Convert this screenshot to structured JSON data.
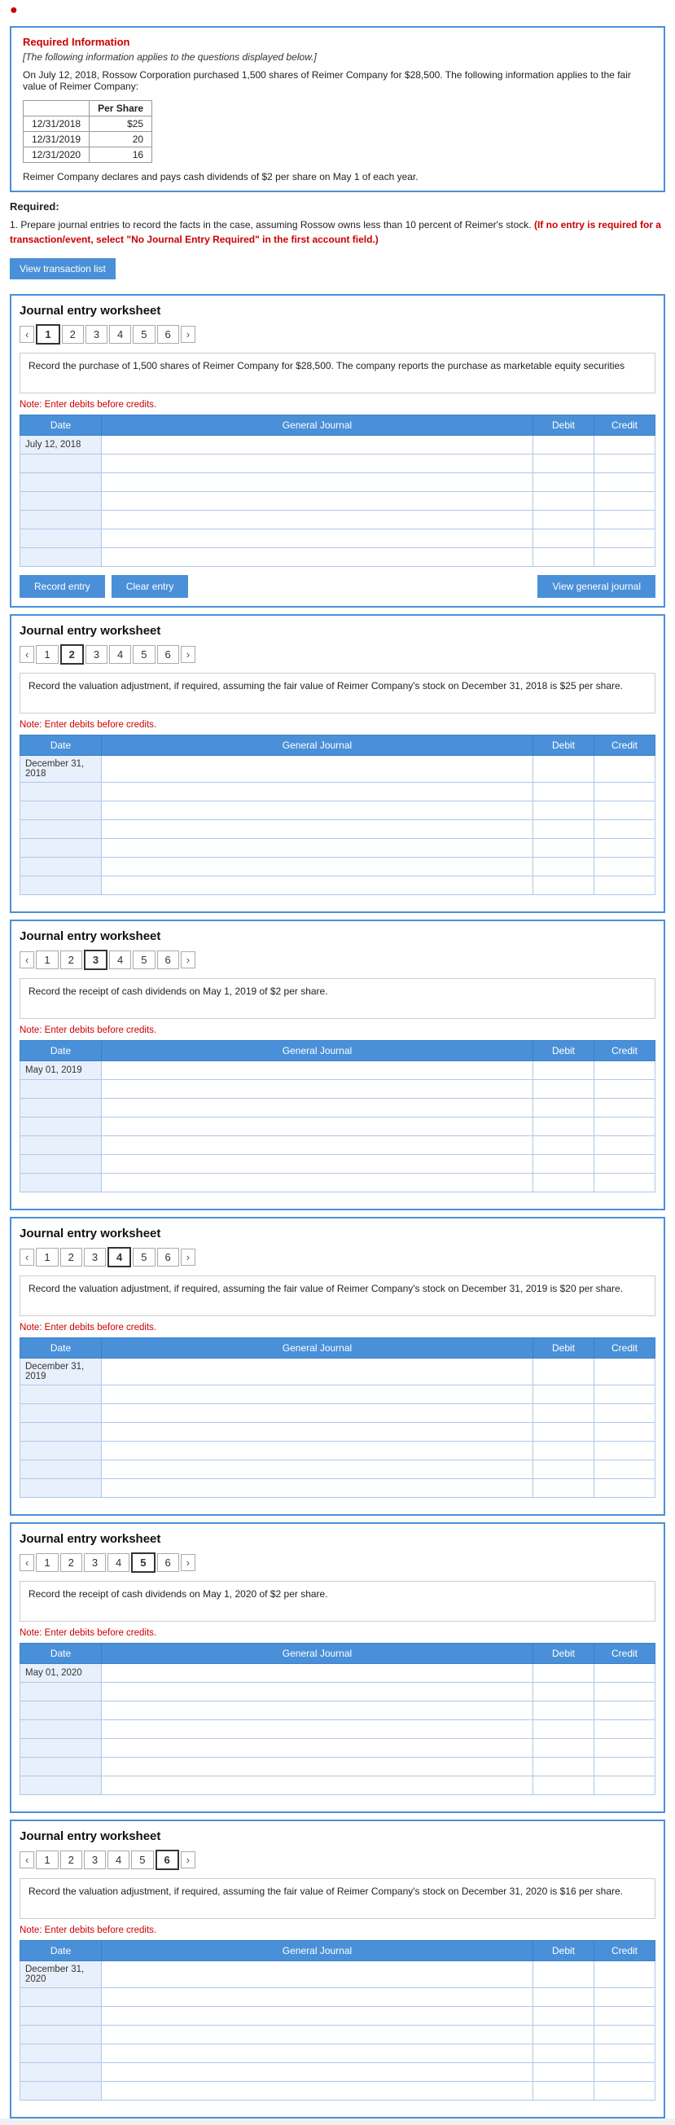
{
  "alert_icon": "!",
  "required_info": {
    "title": "Required Information",
    "subtitle": "[The following information applies to the questions displayed below.]",
    "paragraph": "On July 12, 2018, Rossow Corporation purchased 1,500 shares of Reimer Company for $28,500. The following information applies to the fair value of Reimer Company:",
    "table": {
      "header": [
        "",
        "Per Share"
      ],
      "rows": [
        [
          "12/31/2018",
          "$25"
        ],
        [
          "12/31/2019",
          "20"
        ],
        [
          "12/31/2020",
          "16"
        ]
      ]
    },
    "dividends": "Reimer Company declares and pays cash dividends of $2 per share on May 1 of each year."
  },
  "required_label": "Required:",
  "instruction": "1. Prepare journal entries to record the facts in the case, assuming Rossow owns less than 10 percent of Reimer's stock.",
  "instruction_red": "(If no entry is required for a transaction/event, select \"No Journal Entry Required\" in the first account field.)",
  "view_transaction_btn": "View transaction list",
  "worksheets": [
    {
      "title": "Journal entry worksheet",
      "tabs": [
        1,
        2,
        3,
        4,
        5,
        6
      ],
      "active_tab": 1,
      "instruction": "Record the purchase of 1,500 shares of Reimer Company for $28,500. The company reports the purchase as marketable equity securities",
      "note": "Note: Enter debits before credits.",
      "columns": [
        "Date",
        "General Journal",
        "Debit",
        "Credit"
      ],
      "rows": [
        {
          "date": "July 12, 2018",
          "journal": "",
          "debit": "",
          "credit": ""
        },
        {
          "date": "",
          "journal": "",
          "debit": "",
          "credit": ""
        },
        {
          "date": "",
          "journal": "",
          "debit": "",
          "credit": ""
        },
        {
          "date": "",
          "journal": "",
          "debit": "",
          "credit": ""
        },
        {
          "date": "",
          "journal": "",
          "debit": "",
          "credit": ""
        },
        {
          "date": "",
          "journal": "",
          "debit": "",
          "credit": ""
        },
        {
          "date": "",
          "journal": "",
          "debit": "",
          "credit": ""
        }
      ],
      "buttons": {
        "record": "Record entry",
        "clear": "Clear entry",
        "view": "View general journal"
      }
    },
    {
      "title": "Journal entry worksheet",
      "tabs": [
        1,
        2,
        3,
        4,
        5,
        6
      ],
      "active_tab": 2,
      "instruction": "Record the valuation adjustment, if required, assuming the fair value of Reimer Company's stock on December 31, 2018 is $25 per share.",
      "note": "Note: Enter debits before credits.",
      "columns": [
        "Date",
        "General Journal",
        "Debit",
        "Credit"
      ],
      "rows": [
        {
          "date": "December 31, 2018",
          "journal": "",
          "debit": "",
          "credit": ""
        },
        {
          "date": "",
          "journal": "",
          "debit": "",
          "credit": ""
        },
        {
          "date": "",
          "journal": "",
          "debit": "",
          "credit": ""
        },
        {
          "date": "",
          "journal": "",
          "debit": "",
          "credit": ""
        },
        {
          "date": "",
          "journal": "",
          "debit": "",
          "credit": ""
        },
        {
          "date": "",
          "journal": "",
          "debit": "",
          "credit": ""
        },
        {
          "date": "",
          "journal": "",
          "debit": "",
          "credit": ""
        }
      ],
      "buttons": {
        "record": "Record entry",
        "clear": "Clear entry",
        "view": "View general journal"
      }
    },
    {
      "title": "Journal entry worksheet",
      "tabs": [
        1,
        2,
        3,
        4,
        5,
        6
      ],
      "active_tab": 3,
      "instruction": "Record the receipt of cash dividends on May 1, 2019 of $2 per share.",
      "note": "Note: Enter debits before credits.",
      "columns": [
        "Date",
        "General Journal",
        "Debit",
        "Credit"
      ],
      "rows": [
        {
          "date": "May 01, 2019",
          "journal": "",
          "debit": "",
          "credit": ""
        },
        {
          "date": "",
          "journal": "",
          "debit": "",
          "credit": ""
        },
        {
          "date": "",
          "journal": "",
          "debit": "",
          "credit": ""
        },
        {
          "date": "",
          "journal": "",
          "debit": "",
          "credit": ""
        },
        {
          "date": "",
          "journal": "",
          "debit": "",
          "credit": ""
        },
        {
          "date": "",
          "journal": "",
          "debit": "",
          "credit": ""
        },
        {
          "date": "",
          "journal": "",
          "debit": "",
          "credit": ""
        }
      ],
      "buttons": {
        "record": "Record entry",
        "clear": "Clear entry",
        "view": "View general journal"
      }
    },
    {
      "title": "Journal entry worksheet",
      "tabs": [
        1,
        2,
        3,
        4,
        5,
        6
      ],
      "active_tab": 4,
      "instruction": "Record the valuation adjustment, if required, assuming the fair value of Reimer Company's stock on December 31, 2019 is $20 per share.",
      "note": "Note: Enter debits before credits.",
      "columns": [
        "Date",
        "General Journal",
        "Debit",
        "Credit"
      ],
      "rows": [
        {
          "date": "December 31, 2019",
          "journal": "",
          "debit": "",
          "credit": ""
        },
        {
          "date": "",
          "journal": "",
          "debit": "",
          "credit": ""
        },
        {
          "date": "",
          "journal": "",
          "debit": "",
          "credit": ""
        },
        {
          "date": "",
          "journal": "",
          "debit": "",
          "credit": ""
        },
        {
          "date": "",
          "journal": "",
          "debit": "",
          "credit": ""
        },
        {
          "date": "",
          "journal": "",
          "debit": "",
          "credit": ""
        },
        {
          "date": "",
          "journal": "",
          "debit": "",
          "credit": ""
        }
      ],
      "buttons": {
        "record": "Record entry",
        "clear": "Clear entry",
        "view": "View general journal"
      }
    },
    {
      "title": "Journal entry worksheet",
      "tabs": [
        1,
        2,
        3,
        4,
        5,
        6
      ],
      "active_tab": 5,
      "instruction": "Record the receipt of cash dividends on May 1, 2020 of $2 per share.",
      "note": "Note: Enter debits before credits.",
      "columns": [
        "Date",
        "General Journal",
        "Debit",
        "Credit"
      ],
      "rows": [
        {
          "date": "May 01, 2020",
          "journal": "",
          "debit": "",
          "credit": ""
        },
        {
          "date": "",
          "journal": "",
          "debit": "",
          "credit": ""
        },
        {
          "date": "",
          "journal": "",
          "debit": "",
          "credit": ""
        },
        {
          "date": "",
          "journal": "",
          "debit": "",
          "credit": ""
        },
        {
          "date": "",
          "journal": "",
          "debit": "",
          "credit": ""
        },
        {
          "date": "",
          "journal": "",
          "debit": "",
          "credit": ""
        },
        {
          "date": "",
          "journal": "",
          "debit": "",
          "credit": ""
        }
      ],
      "buttons": {
        "record": "Record entry",
        "clear": "Clear entry",
        "view": "View general journal"
      }
    },
    {
      "title": "Journal entry worksheet",
      "tabs": [
        1,
        2,
        3,
        4,
        5,
        6
      ],
      "active_tab": 6,
      "instruction": "Record the valuation adjustment, if required, assuming the fair value of Reimer Company's stock on December 31, 2020 is $16 per share.",
      "note": "Note: Enter debits before credits.",
      "columns": [
        "Date",
        "General Journal",
        "Debit",
        "Credit"
      ],
      "rows": [
        {
          "date": "December 31, 2020",
          "journal": "",
          "debit": "",
          "credit": ""
        },
        {
          "date": "",
          "journal": "",
          "debit": "",
          "credit": ""
        },
        {
          "date": "",
          "journal": "",
          "debit": "",
          "credit": ""
        },
        {
          "date": "",
          "journal": "",
          "debit": "",
          "credit": ""
        },
        {
          "date": "",
          "journal": "",
          "debit": "",
          "credit": ""
        },
        {
          "date": "",
          "journal": "",
          "debit": "",
          "credit": ""
        },
        {
          "date": "",
          "journal": "",
          "debit": "",
          "credit": ""
        }
      ],
      "buttons": {
        "record": "Record entry",
        "clear": "Clear entry",
        "view": "View general journal"
      }
    }
  ]
}
